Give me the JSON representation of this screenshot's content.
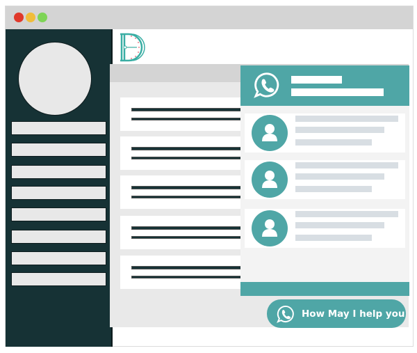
{
  "window": {
    "controls": [
      "close",
      "minimize",
      "maximize"
    ]
  },
  "sidebar": {
    "profile_avatar": "avatar-placeholder",
    "item_count": 8
  },
  "logo": {
    "letter": "D",
    "icon": "clock-d-logo"
  },
  "content": {
    "cards": [
      {
        "lines": 2
      },
      {
        "lines": 2
      },
      {
        "lines": 2
      },
      {
        "lines": 2
      },
      {
        "lines": 2
      }
    ]
  },
  "chat_widget": {
    "header_icon": "whatsapp-icon",
    "contacts": [
      {
        "icon": "user-icon"
      },
      {
        "icon": "user-icon"
      },
      {
        "icon": "user-icon"
      }
    ]
  },
  "help_button": {
    "label": "How May I help you",
    "icon": "whatsapp-icon"
  },
  "colors": {
    "accent": "#4fa6a6",
    "sidebar": "#163235",
    "titlebar": "#d4d4d4",
    "close": "#e0392b",
    "minimize": "#f0bd3b",
    "maximize": "#7ed456"
  }
}
